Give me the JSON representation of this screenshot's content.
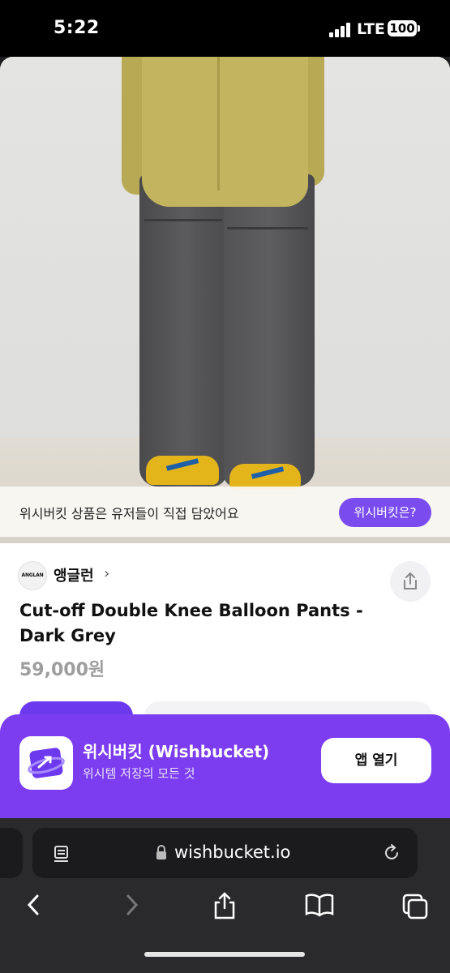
{
  "status_bar": {
    "time": "5:22",
    "network": "LTE",
    "battery": "100"
  },
  "banner": {
    "text": "위시버킷 상품은 유저들이 직접 담았어요",
    "button_label": "위시버킷은?"
  },
  "brand": {
    "logo_text": "ANGLAN",
    "name": "앵글런",
    "chevron": "›"
  },
  "product": {
    "title": "Cut-off Double Knee Balloon Pants - Dark Grey",
    "price": "59,000원"
  },
  "app_banner": {
    "name": "위시버킷 (Wishbucket)",
    "subtitle": "위시템 저장의 모든 것",
    "open_label": "앱 열기"
  },
  "browser": {
    "url": "wishbucket.io"
  },
  "icons": {
    "share": "share-icon",
    "reader": "reader-icon",
    "lock": "lock-icon",
    "reload": "reload-icon",
    "back": "chevron-left-icon",
    "forward": "chevron-right-icon",
    "bookmarks": "book-icon",
    "tabs": "tabs-icon"
  },
  "colors": {
    "accent": "#7a4cf0",
    "banner_bg": "#7c3df0",
    "price": "#9e9e9e"
  }
}
